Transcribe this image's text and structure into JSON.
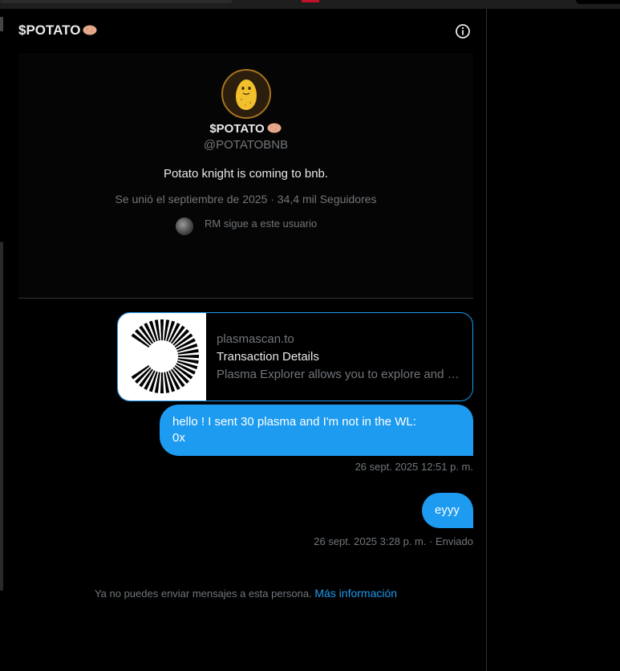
{
  "header": {
    "title": "$POTATO",
    "title_emoji": "potato-emoji",
    "info_icon": "info-icon"
  },
  "profile": {
    "avatar_icon": "potato-avatar",
    "name": "$POTATO",
    "handle": "@POTATOBNB",
    "bio": "Potato knight is coming to bnb.",
    "meta": "Se unió el septiembre de 2025 · 34,4 mil Seguidores",
    "follows_text": "RM sigue a este usuario"
  },
  "link_card": {
    "domain": "plasmascan.to",
    "title": "Transaction Details",
    "description": "Plasma Explorer allows you to explore and search the Plasma blockchain"
  },
  "messages": [
    {
      "line1": "hello ! I sent 30 plasma and I'm not in the WL:",
      "line2": "0x",
      "timestamp": "26 sept. 2025 12:51 p. m."
    },
    {
      "text": "eyyy",
      "timestamp": "26 sept. 2025 3:28 p. m. · Enviado"
    }
  ],
  "notice": {
    "text": "Ya no puedes enviar mensajes a esta persona.",
    "link": "Más información"
  },
  "colors": {
    "accent": "#1d9bf0",
    "muted": "#71767b",
    "background": "#000000"
  }
}
